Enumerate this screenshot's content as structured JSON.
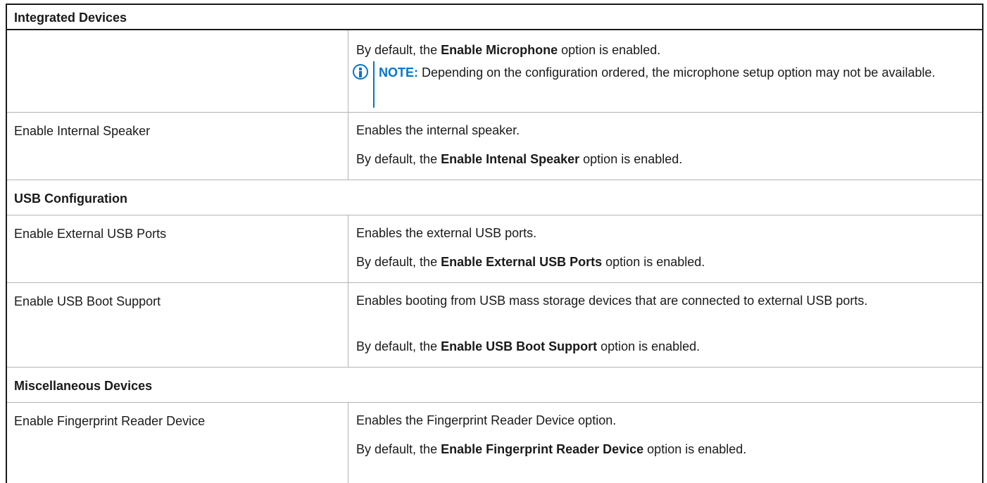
{
  "header": {
    "title": "Integrated Devices"
  },
  "rows": [
    {
      "type": "item",
      "name": "",
      "lines": [
        {
          "pre": "By default, the ",
          "bold": "Enable Microphone",
          "post": " option is enabled."
        }
      ],
      "note": {
        "label": "NOTE:",
        "text": " Depending on the configuration ordered, the microphone setup option may not be available.",
        "icon": "info-icon",
        "color": "#0076ce"
      }
    },
    {
      "type": "item",
      "name": "Enable Internal Speaker",
      "lines": [
        {
          "pre": "Enables the internal speaker.",
          "bold": "",
          "post": ""
        },
        {
          "pre": "By default, the ",
          "bold": "Enable Intenal Speaker",
          "post": " option is enabled."
        }
      ]
    },
    {
      "type": "section",
      "title": "USB Configuration"
    },
    {
      "type": "item",
      "name": "Enable External USB Ports",
      "lines": [
        {
          "pre": "Enables the external USB ports.",
          "bold": "",
          "post": ""
        },
        {
          "pre": "By default, the ",
          "bold": "Enable External USB Ports",
          "post": " option is enabled."
        }
      ]
    },
    {
      "type": "item",
      "name": "Enable USB Boot Support",
      "lines": [
        {
          "pre": "Enables booting from USB mass storage devices that are connected to external USB ports.",
          "bold": "",
          "post": ""
        },
        {
          "pre": "By default, the ",
          "bold": "Enable USB Boot Support",
          "post": " option is enabled."
        }
      ]
    },
    {
      "type": "section",
      "title": "Miscellaneous Devices"
    },
    {
      "type": "item",
      "name": "Enable Fingerprint Reader Device",
      "lines": [
        {
          "pre": "Enables the Fingerprint Reader Device option.",
          "bold": "",
          "post": ""
        },
        {
          "pre": "By default, the ",
          "bold": "Enable Fingerprint Reader Device",
          "post": " option is enabled."
        }
      ]
    }
  ]
}
